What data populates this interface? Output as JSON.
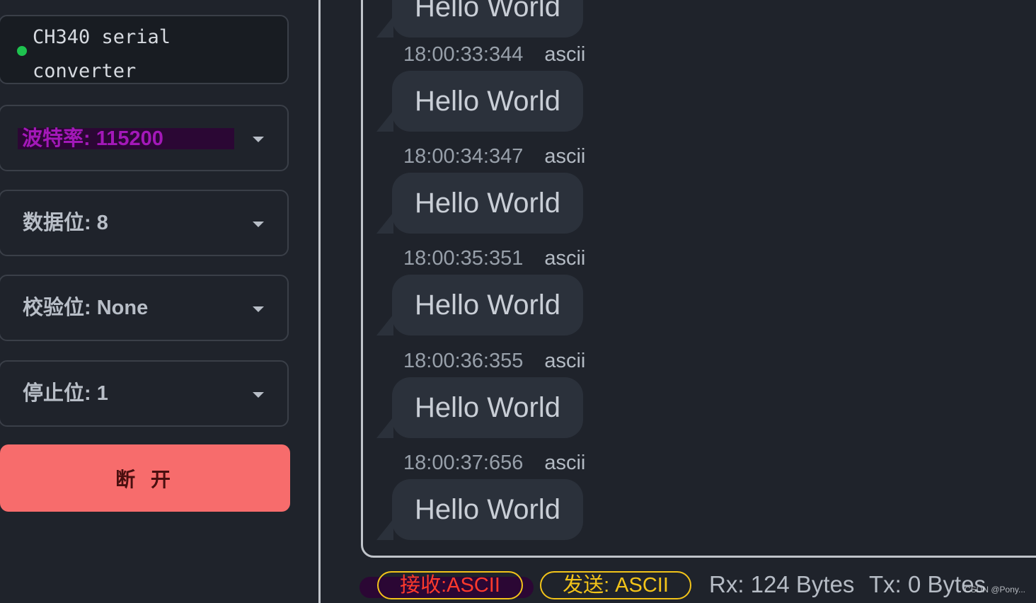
{
  "sidebar": {
    "port_name": "CH340 serial converter",
    "baud": "波特率: 115200",
    "data_bits": "数据位: 8",
    "parity": "校验位: None",
    "stop_bits": "停止位: 1",
    "disconnect_label": "断 开"
  },
  "messages": [
    {
      "time": "",
      "encoding": "",
      "text": "Hello World"
    },
    {
      "time": "18:00:33:344",
      "encoding": "ascii",
      "text": "Hello World"
    },
    {
      "time": "18:00:34:347",
      "encoding": "ascii",
      "text": "Hello World"
    },
    {
      "time": "18:00:35:351",
      "encoding": "ascii",
      "text": "Hello World"
    },
    {
      "time": "18:00:36:355",
      "encoding": "ascii",
      "text": "Hello World"
    },
    {
      "time": "18:00:37:656",
      "encoding": "ascii",
      "text": "Hello World"
    }
  ],
  "status": {
    "rx_mode": "接收:ASCII",
    "tx_mode": "发送: ASCII",
    "rx_bytes": "Rx: 124 Bytes",
    "tx_bytes": "Tx: 0 Bytes",
    "watermark": "CSDN @Pony..."
  },
  "colors": {
    "background": "#1f232b",
    "connected": "#1ec24f",
    "disconnect_button": "#f76c6c",
    "chip_border": "#f3c419"
  }
}
